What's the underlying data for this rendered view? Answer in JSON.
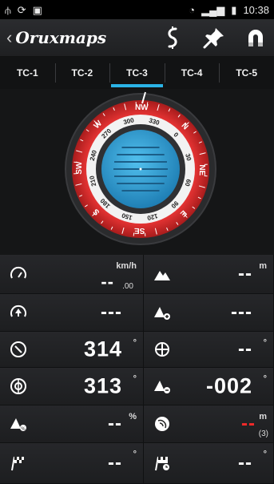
{
  "status_bar": {
    "usb_icon": "usb-icon",
    "time": "10:38",
    "left_icons": [
      "usb-icon",
      "sync-icon",
      "image-icon"
    ],
    "right_icons": [
      "wifi-icon",
      "signal-icon",
      "battery-icon"
    ]
  },
  "action_bar": {
    "back_chevron": "‹",
    "brand_bold": "Oruxmaps",
    "brand_light": "",
    "actions": [
      "route-icon",
      "pin-icon",
      "magnet-icon"
    ]
  },
  "tabs": [
    {
      "label": "TC-1",
      "active": false
    },
    {
      "label": "TC-2",
      "active": false
    },
    {
      "label": "TC-3",
      "active": true
    },
    {
      "label": "TC-4",
      "active": false
    },
    {
      "label": "TC-5",
      "active": false
    }
  ],
  "compass": {
    "cardinal_labels": [
      "NW",
      "N",
      "NE",
      "E",
      "SE",
      "S",
      "SW",
      "W"
    ],
    "degree_labels": [
      "300",
      "330",
      "0",
      "30",
      "60",
      "90",
      "120",
      "150",
      "180",
      "210",
      "240",
      "270"
    ],
    "ring_color": "#d22a2a",
    "face_color": "#3aa7dd"
  },
  "fields": {
    "speed": {
      "value": "--",
      "sub": ".00",
      "unit": "km/h"
    },
    "altitude": {
      "value": "--",
      "unit": "m"
    },
    "up_speed": {
      "value": "---"
    },
    "alt_gain": {
      "value": "---"
    },
    "heading": {
      "value": "314",
      "unit": "°"
    },
    "bearing": {
      "value": "--",
      "unit": "°"
    },
    "course": {
      "value": "313",
      "unit": "°"
    },
    "slope": {
      "value": "-002",
      "unit": "°"
    },
    "grade": {
      "value": "--",
      "unit": "%"
    },
    "gps_accuracy": {
      "value": "--",
      "unit": "m",
      "sub": "(3)"
    },
    "target_bearing": {
      "value": "--",
      "unit": "°"
    },
    "waypoint_bearing": {
      "value": "--",
      "unit": "°"
    }
  }
}
